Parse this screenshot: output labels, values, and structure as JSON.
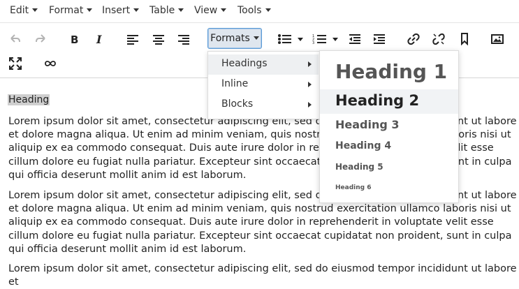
{
  "menubar": {
    "items": [
      {
        "label": "Edit"
      },
      {
        "label": "Format"
      },
      {
        "label": "Insert"
      },
      {
        "label": "Table"
      },
      {
        "label": "View"
      },
      {
        "label": "Tools"
      }
    ]
  },
  "toolbar": {
    "formats_label": "Formats"
  },
  "formats_menu": {
    "items": [
      {
        "label": "Headings"
      },
      {
        "label": "Inline"
      },
      {
        "label": "Blocks"
      }
    ]
  },
  "headings_submenu": {
    "items": [
      {
        "label": "Heading 1"
      },
      {
        "label": "Heading 2"
      },
      {
        "label": "Heading 3"
      },
      {
        "label": "Heading 4"
      },
      {
        "label": "Heading 5"
      },
      {
        "label": "Heading 6"
      }
    ]
  },
  "document": {
    "selected_heading": "Heading",
    "paragraphs": [
      "Lorem ipsum dolor sit amet, consectetur adipiscing elit, sed do eiusmod tempor incididunt ut labore et dolore magna aliqua. Ut enim ad minim veniam, quis nostrud exercitation ullamco laboris nisi ut aliquip ex ea commodo consequat. Duis aute irure dolor in reprehenderit in voluptate velit esse cillum dolore eu fugiat nulla pariatur. Excepteur sint occaecat cupidatat non proident, sunt in culpa qui officia deserunt mollit anim id est laborum.",
      "Lorem ipsum dolor sit amet, consectetur adipiscing elit, sed do eiusmod tempor incididunt ut labore et dolore magna aliqua. Ut enim ad minim veniam, quis nostrud exercitation ullamco laboris nisi ut aliquip ex ea commodo consequat. Duis aute irure dolor in reprehenderit in voluptate velit esse cillum dolore eu fugiat nulla pariatur. Excepteur sint occaecat cupidatat non proident, sunt in culpa qui officia deserunt mollit anim id est laborum.",
      "Lorem ipsum dolor sit amet, consectetur adipiscing elit, sed do eiusmod tempor incididunt ut labore et"
    ]
  },
  "colors": {
    "formats_active_bg": "#dfe6ee",
    "formats_active_border": "#5b9bd5",
    "selection_bg": "#cfcfcf",
    "menu_hover_bg": "#eef0f2"
  }
}
